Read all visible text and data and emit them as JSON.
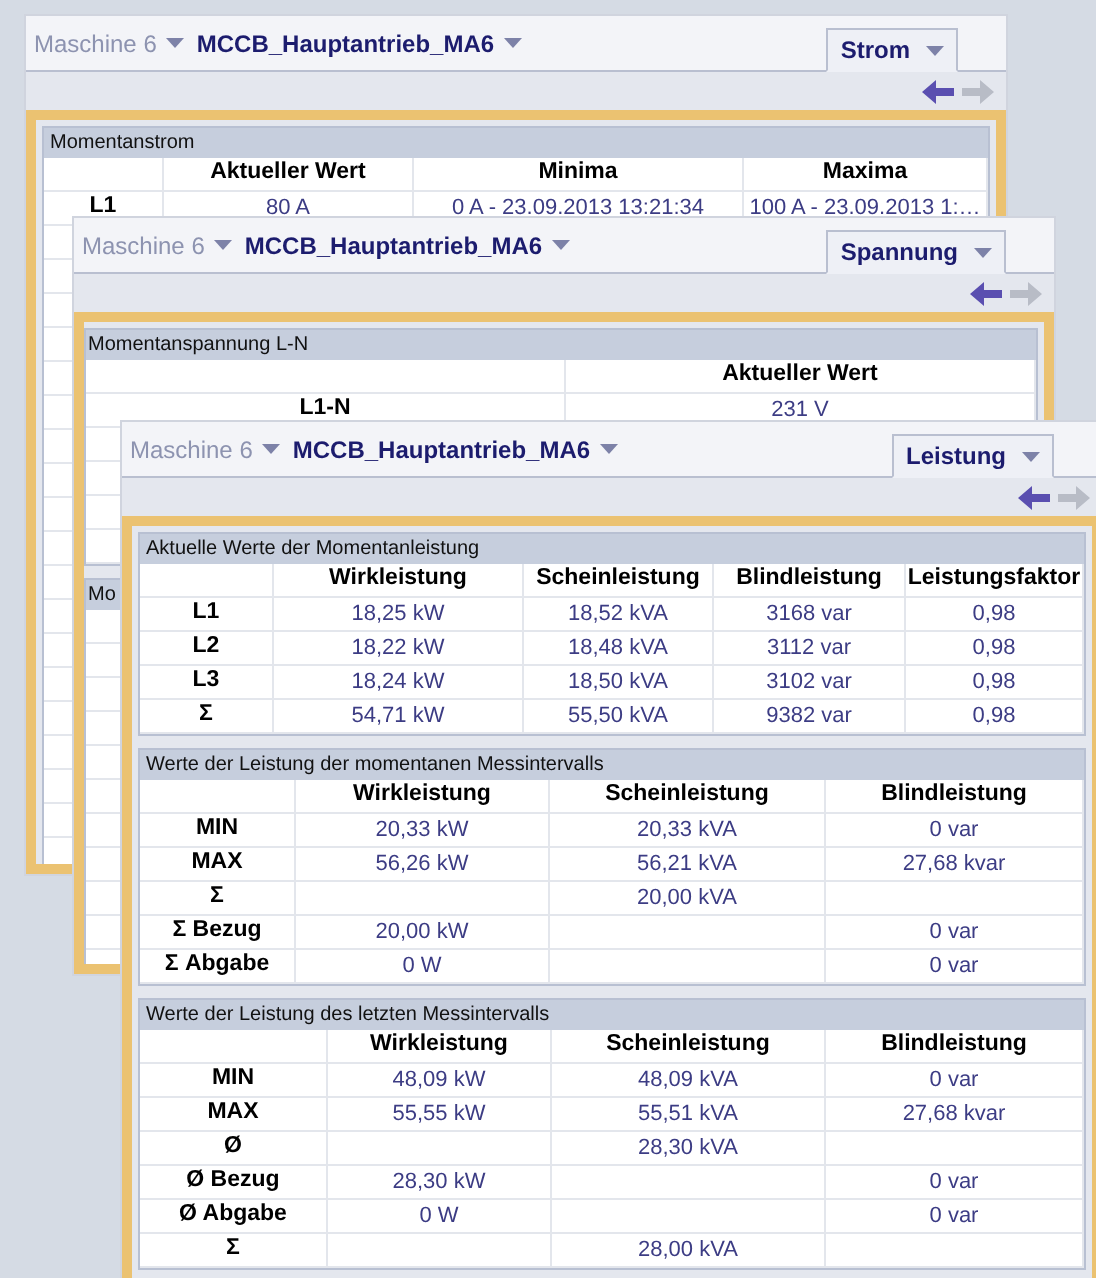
{
  "windows": [
    {
      "breadcrumb": [
        {
          "label": "Maschine 6",
          "kind": "muted"
        },
        {
          "label": "MCCB_Hauptantrieb_MA6",
          "kind": "current"
        }
      ],
      "tab": "Strom",
      "back": {
        "disabled": false
      },
      "forward": {
        "disabled": true
      },
      "panels": [
        {
          "title": "Momentanstrom",
          "columns": [
            "Aktueller Wert",
            "Minima",
            "Maxima"
          ],
          "rows": [
            {
              "label": "L1",
              "cells": [
                "80 A",
                "0 A  -  23.09.2013 13:21:34",
                "100 A  -  23.09.2013 1:…"
              ]
            }
          ]
        }
      ]
    },
    {
      "breadcrumb": [
        {
          "label": "Maschine 6",
          "kind": "muted"
        },
        {
          "label": "MCCB_Hauptantrieb_MA6",
          "kind": "current"
        }
      ],
      "tab": "Spannung",
      "back": {
        "disabled": false
      },
      "forward": {
        "disabled": true
      },
      "panels": [
        {
          "title": "Momentanspannung L-N",
          "columns": [
            "Aktueller Wert"
          ],
          "rows": [
            {
              "label": "L1-N",
              "cells": [
                "231 V"
              ]
            }
          ]
        },
        {
          "title": "Mo"
        }
      ]
    },
    {
      "breadcrumb": [
        {
          "label": "Maschine 6",
          "kind": "muted"
        },
        {
          "label": "MCCB_Hauptantrieb_MA6",
          "kind": "current"
        }
      ],
      "tab": "Leistung",
      "back": {
        "disabled": false
      },
      "forward": {
        "disabled": true
      },
      "panels": [
        {
          "title": "Aktuelle Werte der Momentanleistung",
          "columns": [
            "Wirkleistung",
            "Scheinleistung",
            "Blindleistung",
            "Leistungsfaktor"
          ],
          "rows": [
            {
              "label": "L1",
              "cells": [
                "18,25 kW",
                "18,52 kVA",
                "3168 var",
                "0,98"
              ]
            },
            {
              "label": "L2",
              "cells": [
                "18,22 kW",
                "18,48 kVA",
                "3112 var",
                "0,98"
              ]
            },
            {
              "label": "L3",
              "cells": [
                "18,24 kW",
                "18,50 kVA",
                "3102 var",
                "0,98"
              ]
            },
            {
              "label": "Σ",
              "cells": [
                "54,71 kW",
                "55,50 kVA",
                "9382 var",
                "0,98"
              ]
            }
          ]
        },
        {
          "title": "Werte der Leistung der momentanen Messintervalls",
          "columns": [
            "Wirkleistung",
            "Scheinleistung",
            "Blindleistung"
          ],
          "rows": [
            {
              "label": "MIN",
              "cells": [
                "20,33 kW",
                "20,33 kVA",
                "0 var"
              ]
            },
            {
              "label": "MAX",
              "cells": [
                "56,26 kW",
                "56,21 kVA",
                "27,68 kvar"
              ]
            },
            {
              "label": "Σ",
              "cells": [
                null,
                "20,00 kVA",
                null
              ]
            },
            {
              "label": "Σ Bezug",
              "cells": [
                "20,00 kW",
                null,
                "0 var"
              ]
            },
            {
              "label": "Σ Abgabe",
              "cells": [
                "0 W",
                null,
                "0 var"
              ]
            }
          ]
        },
        {
          "title": "Werte der Leistung des letzten Messintervalls",
          "columns": [
            "Wirkleistung",
            "Scheinleistung",
            "Blindleistung"
          ],
          "rows": [
            {
              "label": "MIN",
              "cells": [
                "48,09 kW",
                "48,09 kVA",
                "0 var"
              ]
            },
            {
              "label": "MAX",
              "cells": [
                "55,55 kW",
                "55,51 kVA",
                "27,68 kvar"
              ]
            },
            {
              "label": "Ø",
              "cells": [
                null,
                "28,30 kVA",
                null
              ]
            },
            {
              "label": "Ø Bezug",
              "cells": [
                "28,30 kW",
                null,
                "0 var"
              ]
            },
            {
              "label": "Ø Abgabe",
              "cells": [
                "0 W",
                null,
                "0 var"
              ]
            },
            {
              "label": "Σ",
              "cells": [
                null,
                "28,00 kVA",
                null
              ]
            }
          ]
        }
      ]
    }
  ]
}
